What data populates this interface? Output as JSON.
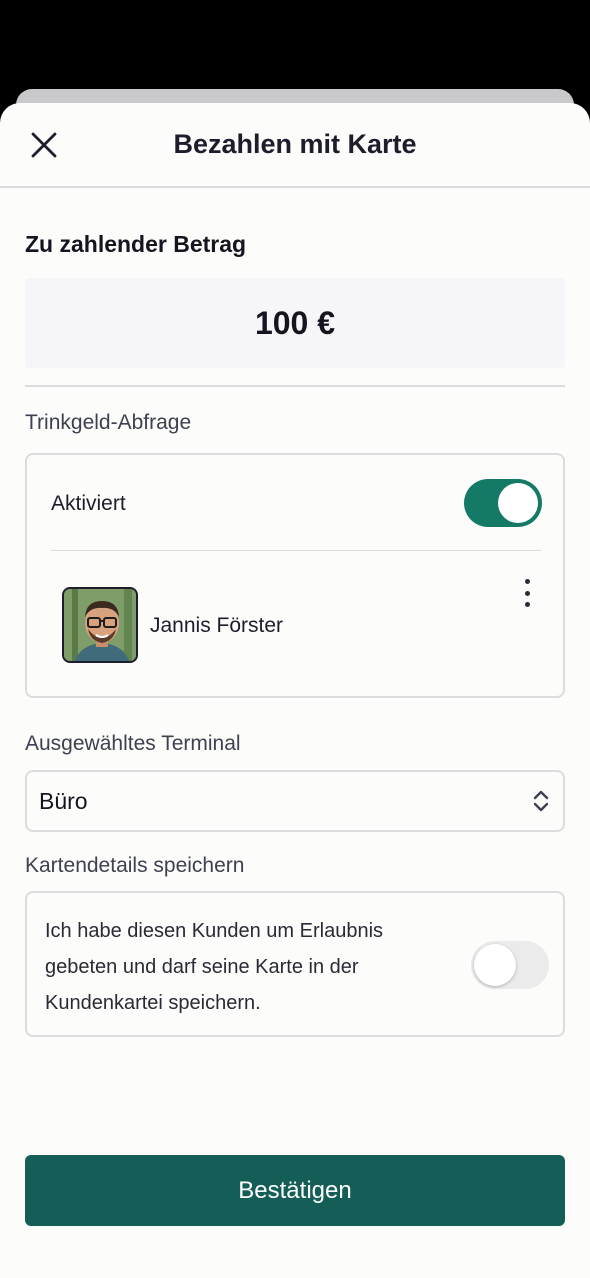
{
  "header": {
    "title": "Bezahlen mit Karte",
    "close_icon": "close-icon"
  },
  "amount": {
    "title": "Zu zahlender Betrag",
    "value": "100 €"
  },
  "tip": {
    "label": "Trinkgeld-Abfrage",
    "status_label": "Aktiviert",
    "enabled": true,
    "person_name": "Jannis Förster",
    "accent_color": "#147a66"
  },
  "terminal": {
    "label": "Ausgewähltes Terminal",
    "selected": "Büro"
  },
  "save_card": {
    "label": "Kartendetails speichern",
    "line1": "Ich habe diesen Kunden um Erlaubnis",
    "line2": "gebeten und darf seine Karte in der",
    "line3": "Kundenkartei speichern.",
    "enabled": false
  },
  "confirm": {
    "label": "Bestätigen",
    "color": "#155e57"
  }
}
